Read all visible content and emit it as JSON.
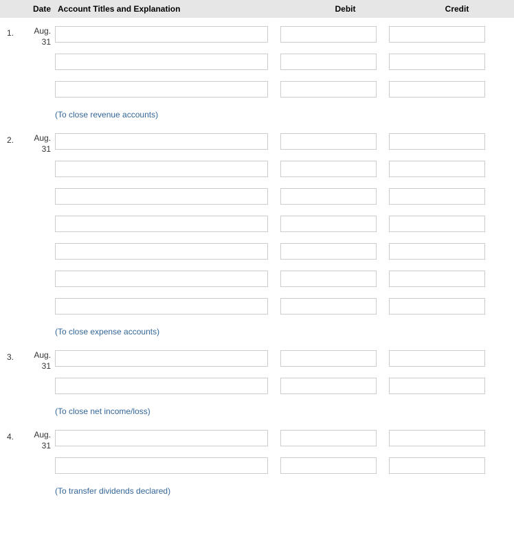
{
  "headers": {
    "date": "Date",
    "account": "Account Titles and Explanation",
    "debit": "Debit",
    "credit": "Credit"
  },
  "entries": [
    {
      "num": "1.",
      "date_month": "Aug.",
      "date_day": "31",
      "lines": 3,
      "explanation": "(To close revenue accounts)"
    },
    {
      "num": "2.",
      "date_month": "Aug.",
      "date_day": "31",
      "lines": 7,
      "explanation": "(To close expense accounts)"
    },
    {
      "num": "3.",
      "date_month": "Aug.",
      "date_day": "31",
      "lines": 2,
      "explanation": "(To close net income/loss)"
    },
    {
      "num": "4.",
      "date_month": "Aug.",
      "date_day": "31",
      "lines": 2,
      "explanation": "(To transfer dividends declared)"
    }
  ]
}
